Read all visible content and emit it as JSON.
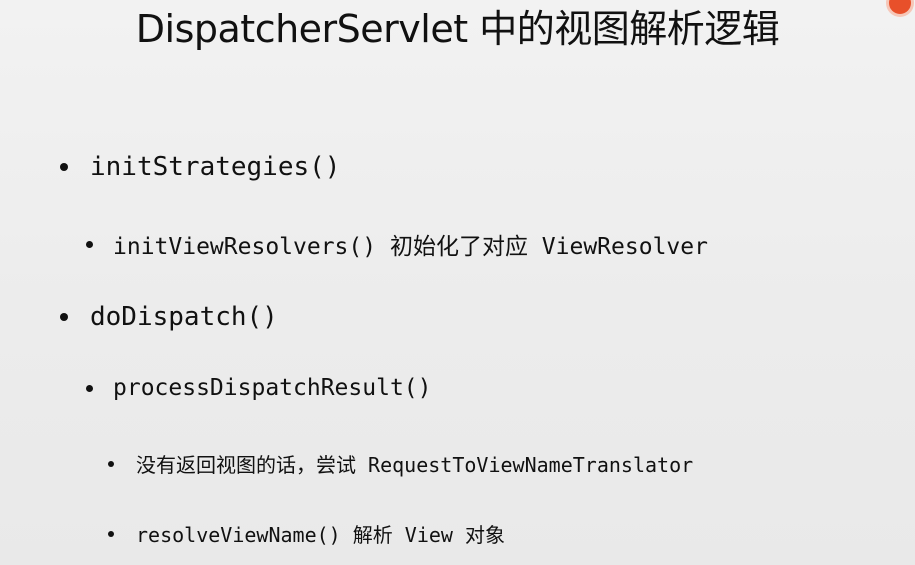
{
  "slide": {
    "title": "DispatcherServlet 中的视图解析逻辑",
    "bullets": [
      {
        "level": 1,
        "text": "initStrategies()"
      },
      {
        "level": 2,
        "text": "initViewResolvers() 初始化了对应 ViewResolver"
      },
      {
        "level": 1,
        "text": "doDispatch()"
      },
      {
        "level": 2,
        "text": "processDispatchResult()"
      },
      {
        "level": 3,
        "text": "没有返回视图的话，尝试 RequestToViewNameTranslator"
      },
      {
        "level": 3,
        "text": "resolveViewName() 解析 View 对象"
      }
    ]
  },
  "colors": {
    "background": "#eeeeee",
    "text": "#111111",
    "corner_mark": "#e8502a"
  },
  "icons": {
    "corner": "recording-indicator-icon"
  }
}
